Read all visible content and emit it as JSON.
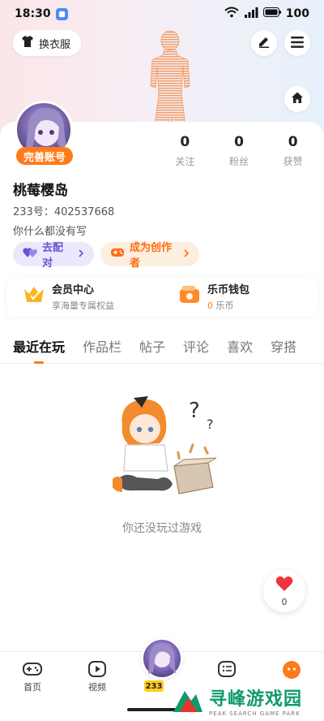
{
  "status_bar": {
    "time": "18:30",
    "battery": "100"
  },
  "header": {
    "outfit_label": "换衣服"
  },
  "profile": {
    "complete_badge": "完善账号",
    "stats": [
      {
        "value": "0",
        "label": "关注"
      },
      {
        "value": "0",
        "label": "粉丝"
      },
      {
        "value": "0",
        "label": "获赞"
      }
    ],
    "username": "桃莓樱岛",
    "uid_label": "233号：402537668",
    "bio": "你什么都没有写",
    "match_chip": "去配对",
    "creator_chip": "成为创作者"
  },
  "member": {
    "title": "会员中心",
    "subtitle": "享海量专属权益",
    "wallet_title": "乐币钱包",
    "wallet_amount": "0",
    "wallet_unit": "乐币"
  },
  "tabs": [
    "最近在玩",
    "作品栏",
    "帖子",
    "评论",
    "喜欢",
    "穿搭"
  ],
  "empty_state": {
    "text": "你还没玩过游戏"
  },
  "like_float": {
    "count": "0"
  },
  "bottom_nav": {
    "home": "首页",
    "video": "视频",
    "center_tag": "233"
  },
  "watermark": {
    "main": "寻峰游戏园",
    "sub": "PEAK SEARCH GAME PARK"
  },
  "colors": {
    "accent": "#ff7a1a",
    "purple": "#6a4fd8",
    "watermark": "#0f9a6e"
  }
}
